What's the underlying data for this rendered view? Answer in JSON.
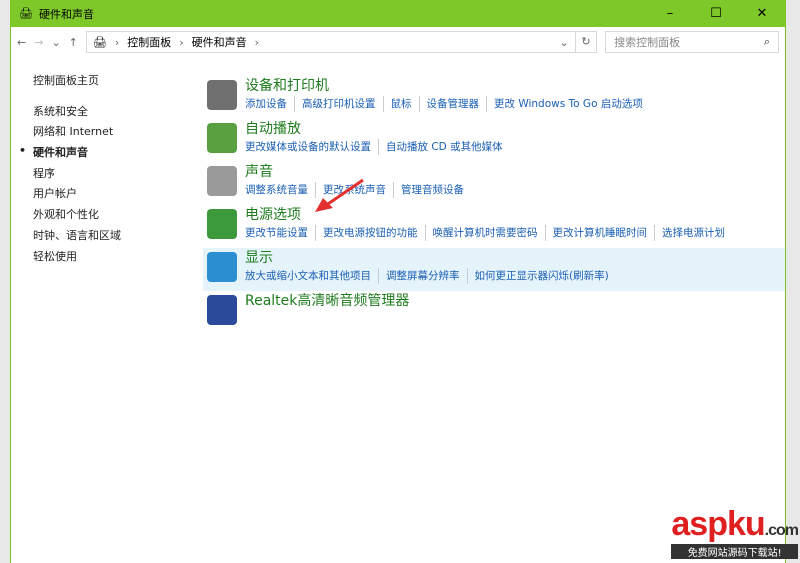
{
  "window": {
    "title": "硬件和声音",
    "minimize": "–",
    "maximize": "☐",
    "close": "✕"
  },
  "nav": {
    "back": "←",
    "forward": "→",
    "recent": "⌄",
    "up": "↑",
    "breadcrumb": [
      "控制面板",
      "硬件和声音"
    ],
    "sep": "›",
    "dropdown": "⌄",
    "refresh": "↻",
    "search_placeholder": "搜索控制面板",
    "search_icon": "⌕"
  },
  "sidebar": {
    "home": "控制面板主页",
    "items": [
      "系统和安全",
      "网络和 Internet",
      "硬件和声音",
      "程序",
      "用户帐户",
      "外观和个性化",
      "时钟、语言和区域",
      "轻松使用"
    ]
  },
  "categories": [
    {
      "title": "设备和打印机",
      "icon": "printer-icon",
      "color": "#707070",
      "links": [
        "添加设备",
        "高级打印机设置",
        "鼠标",
        "设备管理器",
        "更改 Windows To Go 启动选项"
      ]
    },
    {
      "title": "自动播放",
      "icon": "autoplay-icon",
      "color": "#5aa040",
      "links": [
        "更改媒体或设备的默认设置",
        "自动播放 CD 或其他媒体"
      ]
    },
    {
      "title": "声音",
      "icon": "speaker-icon",
      "color": "#9a9a9a",
      "links": [
        "调整系统音量",
        "更改系统声音",
        "管理音频设备"
      ]
    },
    {
      "title": "电源选项",
      "icon": "battery-icon",
      "color": "#3c9a3c",
      "links": [
        "更改节能设置",
        "更改电源按钮的功能",
        "唤醒计算机时需要密码",
        "更改计算机睡眠时间",
        "选择电源计划"
      ]
    },
    {
      "title": "显示",
      "icon": "monitor-icon",
      "color": "#2a8fd0",
      "links": [
        "放大或缩小文本和其他项目",
        "调整屏幕分辨率",
        "如何更正显示器闪烁(刷新率)"
      ]
    },
    {
      "title": "Realtek高清晰音频管理器",
      "icon": "realtek-icon",
      "color": "#2b4a9a",
      "links": []
    }
  ],
  "watermark": {
    "brand": "aspku",
    "domain": ".com",
    "slogan": "免费网站源码下载站!"
  }
}
